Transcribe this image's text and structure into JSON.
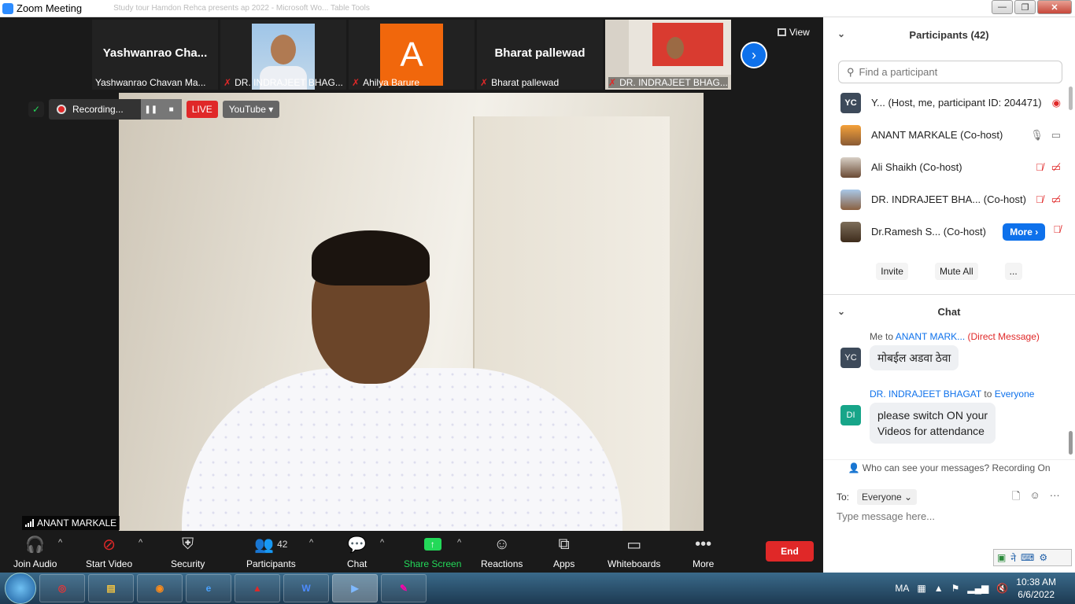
{
  "window": {
    "title": "Zoom Meeting",
    "background_text": "Study tour Hamdon Rehca presents ap 2022 - Microsoft Wo...    Table Tools",
    "min": "—",
    "max": "❐",
    "close": "✕"
  },
  "thumbnails": [
    {
      "big": "Yashwanrao  Cha...",
      "label": "Yashwanrao Chavan Ma...",
      "muted": false,
      "kind": "name"
    },
    {
      "big": "",
      "label": "DR. INDRAJEET BHAG...",
      "muted": true,
      "kind": "photo"
    },
    {
      "big": "A",
      "label": "Ahilya Barure",
      "muted": true,
      "kind": "avatar"
    },
    {
      "big": "Bharat  pallewad",
      "label": "Bharat  pallewad",
      "muted": true,
      "kind": "name"
    },
    {
      "big": "",
      "label": "DR. INDRAJEET BHAG...",
      "muted": true,
      "kind": "room"
    }
  ],
  "view_label": "View",
  "recording": {
    "label": "Recording...",
    "live": "LIVE",
    "stream": "YouTube"
  },
  "active_speaker": "ANANT MARKALE",
  "toolbar": {
    "join_audio": "Join Audio",
    "start_video": "Start Video",
    "security": "Security",
    "participants": "Participants",
    "participants_count": "42",
    "chat": "Chat",
    "share_screen": "Share Screen",
    "reactions": "Reactions",
    "apps": "Apps",
    "whiteboards": "Whiteboards",
    "more": "More",
    "end": "End"
  },
  "participants": {
    "title": "Participants (42)",
    "search_placeholder": "Find a participant",
    "list": [
      {
        "initials": "YC",
        "name": "Y... (Host, me, participant ID: 204471)"
      },
      {
        "initials": "",
        "name": "ANANT MARKALE (Co-host)"
      },
      {
        "initials": "",
        "name": "Ali Shaikh (Co-host)"
      },
      {
        "initials": "",
        "name": "DR. INDRAJEET BHA...   (Co-host)"
      },
      {
        "initials": "",
        "name": "Dr.Ramesh S...  (Co-host)"
      }
    ],
    "more_label": "More",
    "invite": "Invite",
    "mute_all": "Mute All",
    "ellipsis": "..."
  },
  "chat": {
    "title": "Chat",
    "messages": [
      {
        "initials": "YC",
        "from": "Me",
        "to_word": "to",
        "to": "ANANT MARK...",
        "tag": "(Direct Message)",
        "text": "मोबईल अडवा ठेवा"
      },
      {
        "initials": "DI",
        "from": "DR. INDRAJEET BHAGAT",
        "to_word": "to",
        "to": "Everyone",
        "tag": "",
        "text_line1": "please switch ON your",
        "text_line2": "Videos for attendance"
      }
    ],
    "who_can_see": "Who can see your messages? Recording On",
    "to_label": "To:",
    "to_value": "Everyone",
    "input_placeholder": "Type message here..."
  },
  "taskbar": {
    "tray_lang": "MA",
    "time": "10:38 AM",
    "date": "6/6/2022"
  },
  "colors": {
    "accent": "#0e71eb",
    "danger": "#e02828",
    "share": "#23d959"
  }
}
